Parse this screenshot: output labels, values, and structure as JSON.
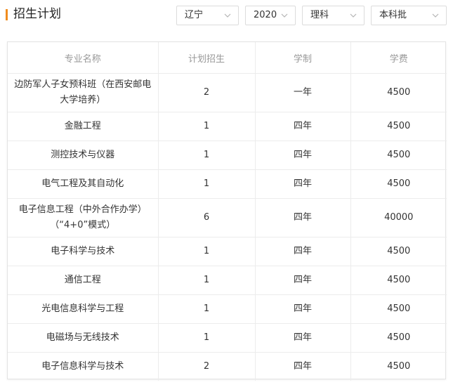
{
  "header": {
    "title": "招生计划",
    "accent_color": "#f08c1e"
  },
  "filters": {
    "province": "辽宁",
    "year": "2020",
    "subject": "理科",
    "batch": "本科批",
    "chevron_icon": "chevron-down-icon"
  },
  "table": {
    "columns": [
      "专业名称",
      "计划招生",
      "学制",
      "学费"
    ],
    "rows": [
      {
        "major": "边防军人子女预科班（在西安邮电大学培养）",
        "plan": "2",
        "duration": "一年",
        "fee": "4500"
      },
      {
        "major": "金融工程",
        "plan": "1",
        "duration": "四年",
        "fee": "4500"
      },
      {
        "major": "测控技术与仪器",
        "plan": "1",
        "duration": "四年",
        "fee": "4500"
      },
      {
        "major": "电气工程及其自动化",
        "plan": "1",
        "duration": "四年",
        "fee": "4500"
      },
      {
        "major": "电子信息工程（中外合作办学）（“4+0”模式）",
        "plan": "6",
        "duration": "四年",
        "fee": "40000"
      },
      {
        "major": "电子科学与技术",
        "plan": "1",
        "duration": "四年",
        "fee": "4500"
      },
      {
        "major": "通信工程",
        "plan": "1",
        "duration": "四年",
        "fee": "4500"
      },
      {
        "major": "光电信息科学与工程",
        "plan": "1",
        "duration": "四年",
        "fee": "4500"
      },
      {
        "major": "电磁场与无线技术",
        "plan": "1",
        "duration": "四年",
        "fee": "4500"
      },
      {
        "major": "电子信息科学与技术",
        "plan": "2",
        "duration": "四年",
        "fee": "4500"
      }
    ]
  }
}
